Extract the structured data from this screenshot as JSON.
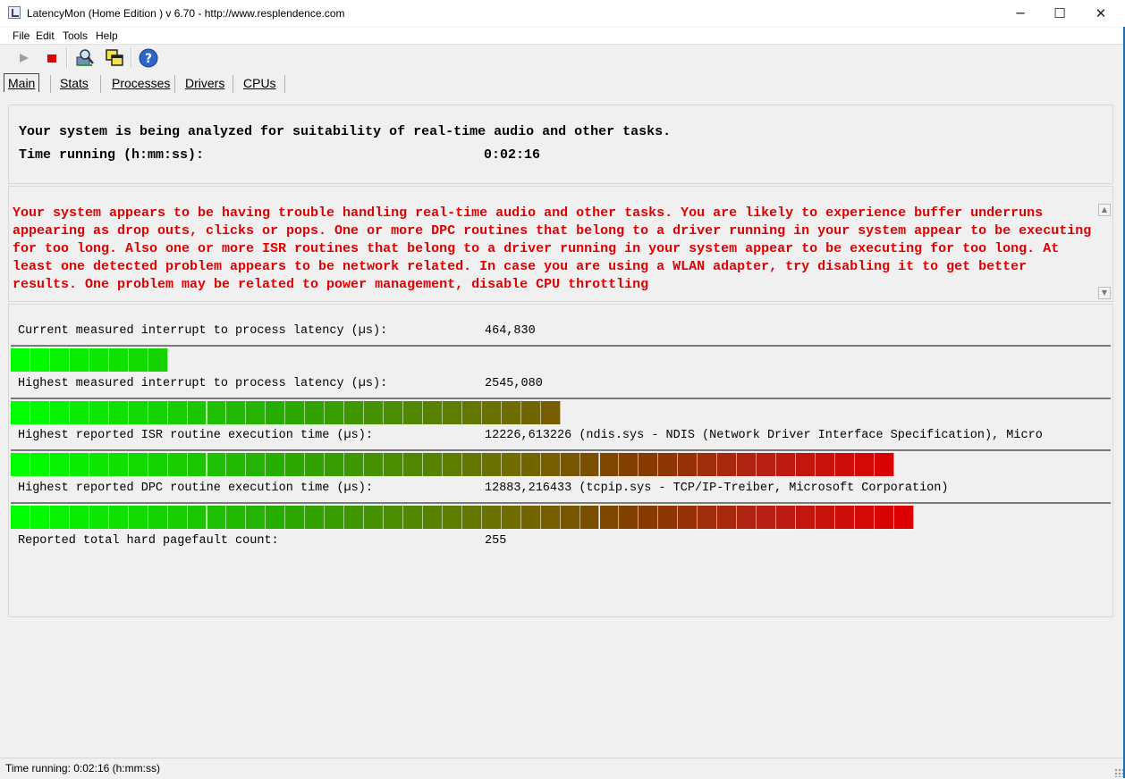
{
  "window": {
    "title": "LatencyMon  (Home Edition )  v 6.70 - http://www.resplendence.com",
    "minimize": "─",
    "maximize": "☐",
    "close": "✕"
  },
  "menu": [
    "File",
    "Edit",
    "Tools",
    "Help"
  ],
  "toolbar": {
    "start_icon": "play-icon",
    "stop_icon": "stop-icon",
    "analyze_icon": "monitor-search-icon",
    "windows_icon": "windows-icon",
    "help_icon": "help-icon"
  },
  "tabs": [
    {
      "label": "Main",
      "active": true
    },
    {
      "label": "Stats",
      "active": false
    },
    {
      "label": "Processes",
      "active": false
    },
    {
      "label": "Drivers",
      "active": false
    },
    {
      "label": "CPUs",
      "active": false
    }
  ],
  "summary": {
    "line1": "Your system is being analyzed for suitability of real-time audio and other tasks.",
    "time_label": "Time running (h:mm:ss):",
    "time_value": "0:02:16"
  },
  "warning": {
    "text": "Your system appears to be having trouble handling real-time audio and other tasks. You are likely to experience buffer underruns appearing as drop outs, clicks or pops. One or more DPC routines that belong to a driver running in your system appear to be executing for too long. Also one or more ISR routines that belong to a driver running in your system appear to be executing for too long. At least one detected problem appears to be network related. In case you are using a WLAN adapter, try disabling it to get better results. One problem may be related to power management, disable CPU throttling",
    "color": "#e00000"
  },
  "metrics": {
    "current_latency": {
      "label": "Current measured interrupt to process latency (µs):",
      "value": "464,830",
      "segments": 8
    },
    "highest_latency": {
      "label": "Highest measured interrupt to process latency (µs):",
      "value": "2545,080",
      "segments": 28
    },
    "isr": {
      "label": "Highest reported ISR routine execution time (µs):",
      "value": "12226,613226  (ndis.sys - NDIS (Network Driver Interface Specification), Micro",
      "segments": 45
    },
    "dpc": {
      "label": "Highest reported DPC routine execution time (µs):",
      "value": "12883,216433  (tcpip.sys - TCP/IP-Treiber, Microsoft Corporation)",
      "segments": 46
    },
    "pagefault": {
      "label": "Reported total hard pagefault count:",
      "value": "255"
    }
  },
  "statusbar": {
    "text": "Time running: 0:02:16  (h:mm:ss)"
  }
}
